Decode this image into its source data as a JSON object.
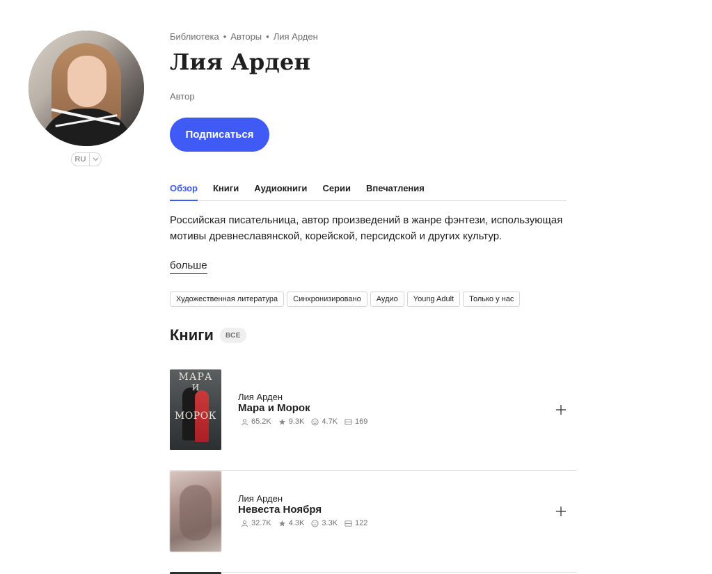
{
  "author": {
    "name": "Лия Арден",
    "role": "Автор",
    "language": "RU",
    "bio": "Российская писательница, автор произведений в жанре фэнтези, использующая мотивы древнеславянской, корейской, персидской и других культур.",
    "more_label": "больше"
  },
  "breadcrumb": [
    "Библиотека",
    "Авторы",
    "Лия Арден"
  ],
  "actions": {
    "subscribe_label": "Подписаться"
  },
  "tabs": [
    {
      "label": "Обзор",
      "active": true
    },
    {
      "label": "Книги",
      "active": false
    },
    {
      "label": "Аудиокниги",
      "active": false
    },
    {
      "label": "Серии",
      "active": false
    },
    {
      "label": "Впечатления",
      "active": false
    }
  ],
  "tags": [
    "Художественная литература",
    "Синхронизировано",
    "Аудио",
    "Young Adult",
    "Только у нас"
  ],
  "books_section": {
    "title": "Книги",
    "all_label": "ВСЕ"
  },
  "books": [
    {
      "author": "Лия Арден",
      "title": "Мара и Морок",
      "readers": "65.2K",
      "likes": "9.3K",
      "impressions": "4.7K",
      "quotes": "169",
      "cover_text": [
        "МАРА",
        "И",
        "МОРОК"
      ]
    },
    {
      "author": "Лия Арден",
      "title": "Невеста Ноября",
      "readers": "32.7K",
      "likes": "4.3K",
      "impressions": "3.3K",
      "quotes": "122"
    }
  ],
  "colors": {
    "accent": "#3f5af5",
    "text": "#1f1f1f",
    "muted": "#6f6f6f",
    "divider": "#dcdcdc"
  }
}
